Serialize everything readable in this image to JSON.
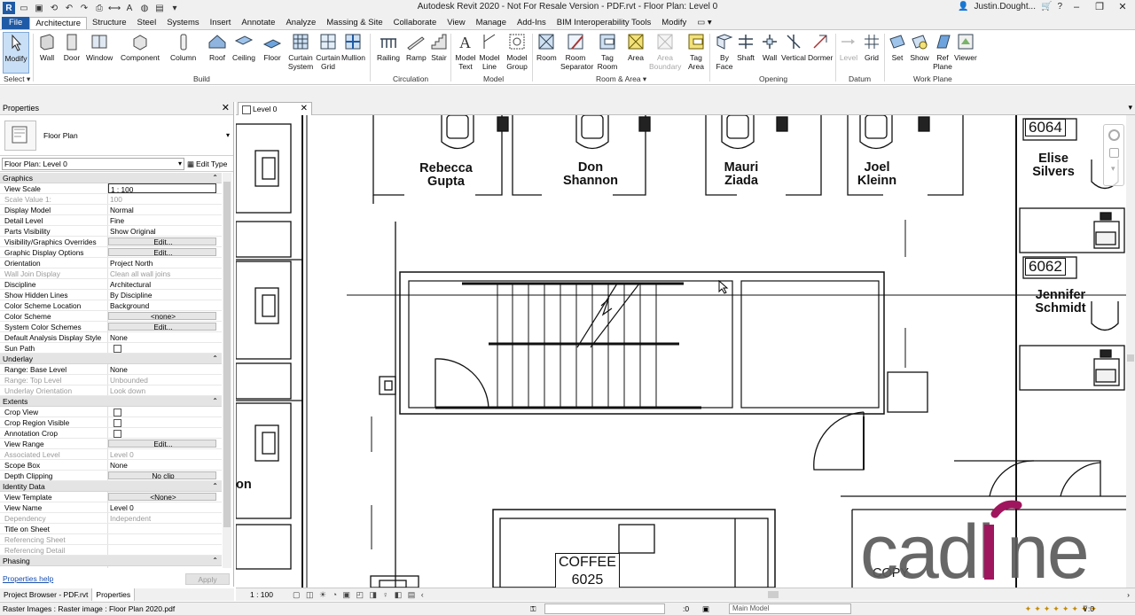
{
  "window": {
    "title": "Autodesk Revit 2020 - Not For Resale Version - PDF.rvt - Floor Plan: Level 0",
    "user": "Justin.Dought...",
    "help": "?"
  },
  "ribbon_tabs": [
    "File",
    "Architecture",
    "Structure",
    "Steel",
    "Systems",
    "Insert",
    "Annotate",
    "Analyze",
    "Massing & Site",
    "Collaborate",
    "View",
    "Manage",
    "Add-Ins",
    "BIM Interoperability Tools",
    "Modify"
  ],
  "active_tab": "Architecture",
  "ribbon": {
    "select": {
      "modify": "Modify",
      "label": "Select"
    },
    "build": {
      "label": "Build",
      "buttons": [
        "Wall",
        "Door",
        "Window",
        "Component",
        "Column",
        "Roof",
        "Ceiling",
        "Floor",
        "Curtain System",
        "Curtain Grid",
        "Mullion"
      ]
    },
    "circulation": {
      "label": "Circulation",
      "buttons": [
        "Railing",
        "Ramp",
        "Stair"
      ]
    },
    "model": {
      "label": "Model",
      "buttons": [
        "Model Text",
        "Model Line",
        "Model Group"
      ]
    },
    "room_area": {
      "label": "Room & Area",
      "buttons": [
        "Room",
        "Room Separator",
        "Tag Room",
        "Area",
        "Area Boundary",
        "Tag Area"
      ]
    },
    "opening": {
      "label": "Opening",
      "buttons": [
        "By Face",
        "Shaft",
        "Wall",
        "Vertical",
        "Dormer"
      ]
    },
    "datum": {
      "label": "Datum",
      "buttons": [
        "Level",
        "Grid"
      ]
    },
    "work_plane": {
      "label": "Work Plane",
      "buttons": [
        "Set",
        "Show",
        "Ref Plane",
        "Viewer"
      ]
    }
  },
  "properties": {
    "title": "Properties",
    "type_name": "Floor Plan",
    "instance": "Floor Plan: Level 0",
    "edit_type": "Edit Type",
    "groups": [
      {
        "name": "Graphics",
        "rows": [
          {
            "name": "View Scale",
            "value": "1 : 100",
            "kind": "input"
          },
          {
            "name": "Scale Value    1:",
            "value": "100",
            "kind": "disabled"
          },
          {
            "name": "Display Model",
            "value": "Normal"
          },
          {
            "name": "Detail Level",
            "value": "Fine"
          },
          {
            "name": "Parts Visibility",
            "value": "Show Original"
          },
          {
            "name": "Visibility/Graphics Overrides",
            "value": "Edit...",
            "kind": "button"
          },
          {
            "name": "Graphic Display Options",
            "value": "Edit...",
            "kind": "button"
          },
          {
            "name": "Orientation",
            "value": "Project North"
          },
          {
            "name": "Wall Join Display",
            "value": "Clean all wall joins",
            "kind": "disabled"
          },
          {
            "name": "Discipline",
            "value": "Architectural"
          },
          {
            "name": "Show Hidden Lines",
            "value": "By Discipline"
          },
          {
            "name": "Color Scheme Location",
            "value": "Background"
          },
          {
            "name": "Color Scheme",
            "value": "<none>",
            "kind": "button"
          },
          {
            "name": "System Color Schemes",
            "value": "Edit...",
            "kind": "button"
          },
          {
            "name": "Default Analysis Display Style",
            "value": "None"
          },
          {
            "name": "Sun Path",
            "value": "",
            "kind": "checkbox"
          }
        ]
      },
      {
        "name": "Underlay",
        "rows": [
          {
            "name": "Range: Base Level",
            "value": "None"
          },
          {
            "name": "Range: Top Level",
            "value": "Unbounded",
            "kind": "disabled"
          },
          {
            "name": "Underlay Orientation",
            "value": "Look down",
            "kind": "disabled"
          }
        ]
      },
      {
        "name": "Extents",
        "rows": [
          {
            "name": "Crop View",
            "value": "",
            "kind": "checkbox"
          },
          {
            "name": "Crop Region Visible",
            "value": "",
            "kind": "checkbox"
          },
          {
            "name": "Annotation Crop",
            "value": "",
            "kind": "checkbox"
          },
          {
            "name": "View Range",
            "value": "Edit...",
            "kind": "button"
          },
          {
            "name": "Associated Level",
            "value": "Level 0",
            "kind": "disabled"
          },
          {
            "name": "Scope Box",
            "value": "None"
          },
          {
            "name": "Depth Clipping",
            "value": "No clip",
            "kind": "button"
          }
        ]
      },
      {
        "name": "Identity Data",
        "rows": [
          {
            "name": "View Template",
            "value": "<None>",
            "kind": "button"
          },
          {
            "name": "View Name",
            "value": "Level 0"
          },
          {
            "name": "Dependency",
            "value": "Independent",
            "kind": "disabled"
          },
          {
            "name": "Title on Sheet",
            "value": ""
          },
          {
            "name": "Referencing Sheet",
            "value": "",
            "kind": "disabled"
          },
          {
            "name": "Referencing Detail",
            "value": "",
            "kind": "disabled"
          }
        ]
      },
      {
        "name": "Phasing",
        "rows": [
          {
            "name": "Phase Filter",
            "value": "Show All"
          }
        ]
      }
    ],
    "help_link": "Properties help",
    "apply": "Apply"
  },
  "bottom_tabs": [
    "Project Browser - PDF.rvt",
    "Properties"
  ],
  "active_bottom_tab": "Properties",
  "view": {
    "tab_name": "Level 0",
    "scale": "1 : 100"
  },
  "plan": {
    "people": [
      "Rebecca\nGupta",
      "Don\nShannon",
      "Mauri\nZiada",
      "Joel\nKleinn",
      "Elise\nSilvers",
      "Jennifer\nSchmidt"
    ],
    "room_tags": [
      "6064",
      "6062"
    ],
    "coffee_room": "COFFEE\n6025",
    "partial_text": "on",
    "copy_text": "COPY"
  },
  "status": {
    "text": "Raster Images : Raster image : Floor Plan 2020.pdf",
    "coord": ":0",
    "model": "Main Model"
  },
  "brand": {
    "logo": "cadline",
    "accent": "#a0165e",
    "revit_blue": "#1f5aa6"
  }
}
